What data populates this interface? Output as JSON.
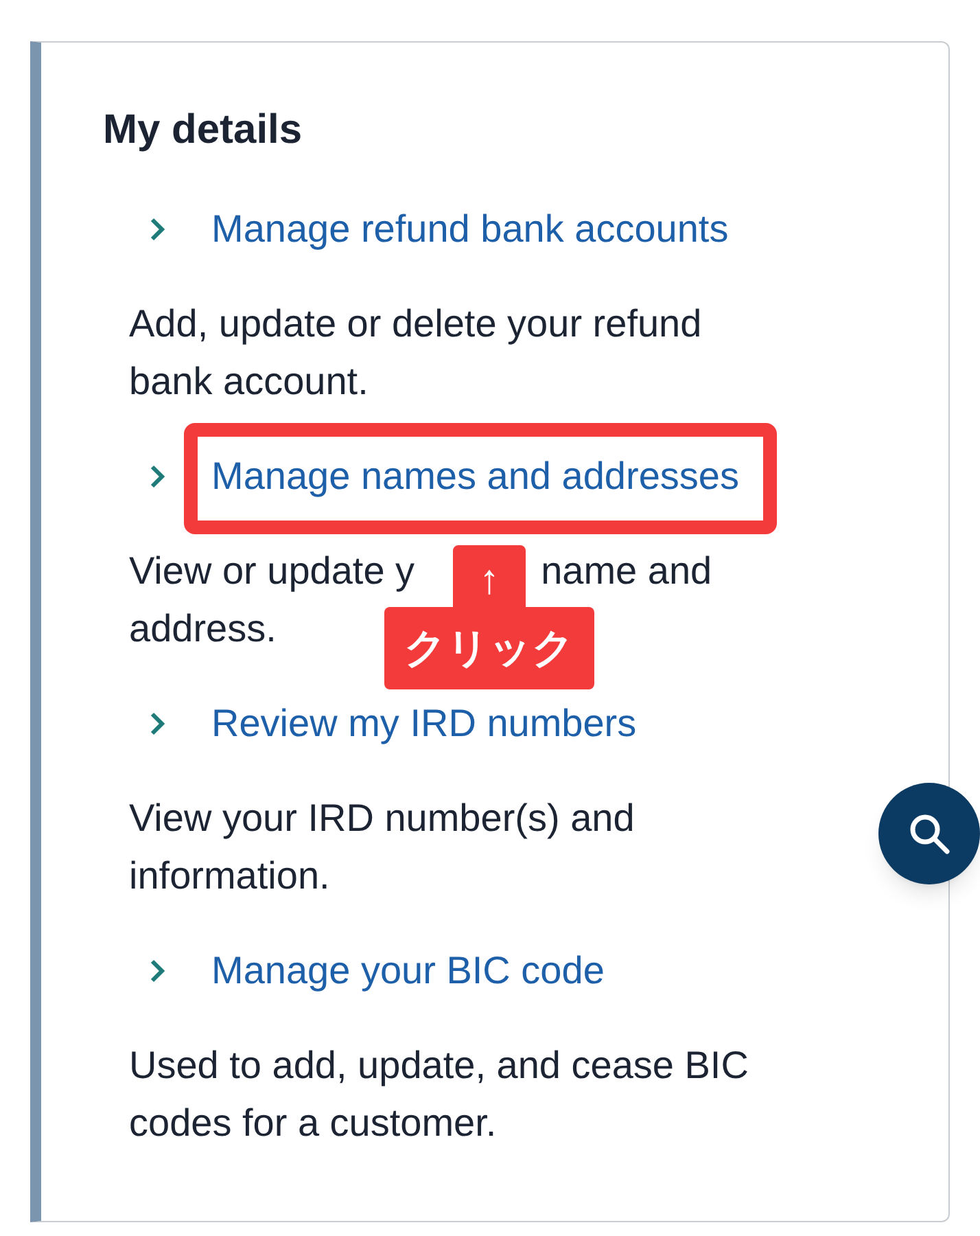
{
  "section": {
    "title": "My details",
    "items": [
      {
        "link": "Manage refund bank accounts",
        "highlighted": false,
        "description": [
          "Add, update or delete your refund bank account."
        ]
      },
      {
        "link": "Manage names and addresses",
        "highlighted": true,
        "description": [
          "View or update y",
          "name and",
          "address."
        ]
      },
      {
        "link": "Review my IRD numbers",
        "highlighted": false,
        "description": [
          "View your IRD number(s) and information."
        ]
      },
      {
        "link": "Manage your BIC code",
        "highlighted": false,
        "description": [
          "Used to add, update, and cease BIC codes for a customer."
        ]
      }
    ]
  },
  "annotation": {
    "arrow": "↑",
    "label": "クリック"
  },
  "search_button": {
    "kind": "floating"
  }
}
